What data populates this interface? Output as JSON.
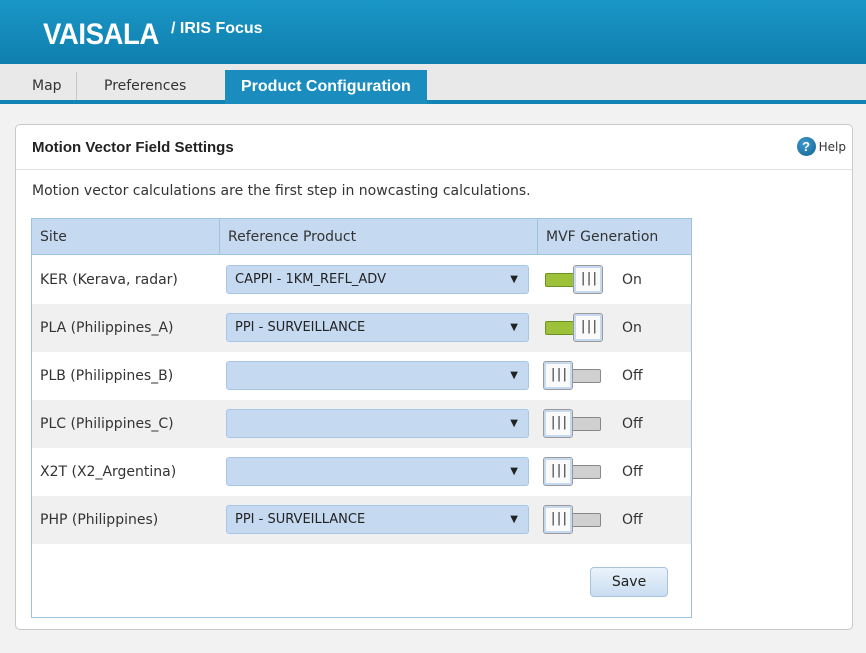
{
  "header": {
    "logo": "VAISALA",
    "product": "/ IRIS Focus"
  },
  "tabs": [
    {
      "label": "Map",
      "active": false
    },
    {
      "label": "Preferences",
      "active": false
    },
    {
      "label": "Product Configuration",
      "active": true
    }
  ],
  "panel": {
    "title": "Motion Vector Field Settings",
    "help_label": "Help",
    "help_icon_glyph": "?",
    "description": "Motion vector calculations are the first step in nowcasting calculations.",
    "save_label": "Save"
  },
  "table": {
    "columns": [
      "Site",
      "Reference Product",
      "MVF Generation"
    ],
    "rows": [
      {
        "site": "KER (Kerava, radar)",
        "product": "CAPPI - 1KM_REFL_ADV",
        "mvf_on": true,
        "state": "On"
      },
      {
        "site": "PLA (Philippines_A)",
        "product": "PPI - SURVEILLANCE",
        "mvf_on": true,
        "state": "On"
      },
      {
        "site": "PLB (Philippines_B)",
        "product": "",
        "mvf_on": false,
        "state": "Off"
      },
      {
        "site": "PLC (Philippines_C)",
        "product": "",
        "mvf_on": false,
        "state": "Off"
      },
      {
        "site": "X2T (X2_Argentina)",
        "product": "",
        "mvf_on": false,
        "state": "Off"
      },
      {
        "site": "PHP (Philippines)",
        "product": "PPI - SURVEILLANCE",
        "mvf_on": false,
        "state": "Off"
      }
    ],
    "select_arrow": "▼",
    "knob_glyph": "|||"
  },
  "colors": {
    "header": "#1384b6",
    "toggle_on": "#9cc23a",
    "toggle_off": "#d0d0d0",
    "select_bg": "#c5daf0"
  }
}
